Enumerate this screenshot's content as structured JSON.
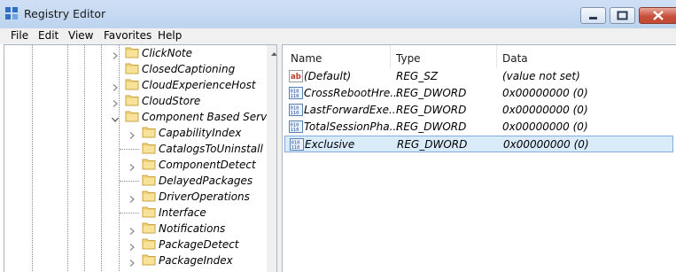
{
  "window": {
    "title": "Registry Editor",
    "accent": "#bcd3ee"
  },
  "menu": {
    "items": [
      "File",
      "Edit",
      "View",
      "Favorites",
      "Help"
    ]
  },
  "tree": {
    "items": [
      {
        "label": "ClickNote",
        "level": 1,
        "expander": "collapsed"
      },
      {
        "label": "ClosedCaptioning",
        "level": 1,
        "expander": "none"
      },
      {
        "label": "CloudExperienceHost",
        "level": 1,
        "expander": "collapsed"
      },
      {
        "label": "CloudStore",
        "level": 1,
        "expander": "collapsed"
      },
      {
        "label": "Component Based Servici",
        "level": 1,
        "expander": "expanded"
      },
      {
        "label": "CapabilityIndex",
        "level": 2,
        "expander": "collapsed"
      },
      {
        "label": "CatalogsToUninstall",
        "level": 2,
        "expander": "none"
      },
      {
        "label": "ComponentDetect",
        "level": 2,
        "expander": "collapsed"
      },
      {
        "label": "DelayedPackages",
        "level": 2,
        "expander": "none"
      },
      {
        "label": "DriverOperations",
        "level": 2,
        "expander": "collapsed"
      },
      {
        "label": "Interface",
        "level": 2,
        "expander": "none"
      },
      {
        "label": "Notifications",
        "level": 2,
        "expander": "collapsed"
      },
      {
        "label": "PackageDetect",
        "level": 2,
        "expander": "collapsed"
      },
      {
        "label": "PackageIndex",
        "level": 2,
        "expander": "collapsed"
      }
    ]
  },
  "values": {
    "headers": {
      "name": "Name",
      "type": "Type",
      "data": "Data"
    },
    "rows": [
      {
        "icon": "string-value-icon",
        "name": "(Default)",
        "type": "REG_SZ",
        "data": "(value not set)",
        "selected": false
      },
      {
        "icon": "dword-value-icon",
        "name": "CrossRebootHre...",
        "type": "REG_DWORD",
        "data": "0x00000000 (0)",
        "selected": false
      },
      {
        "icon": "dword-value-icon",
        "name": "LastForwardExe...",
        "type": "REG_DWORD",
        "data": "0x00000000 (0)",
        "selected": false
      },
      {
        "icon": "dword-value-icon",
        "name": "TotalSessionPha...",
        "type": "REG_DWORD",
        "data": "0x00000000 (0)",
        "selected": false
      },
      {
        "icon": "dword-value-icon",
        "name": "Exclusive",
        "type": "REG_DWORD",
        "data": "0x00000000 (0)",
        "selected": true
      }
    ]
  }
}
